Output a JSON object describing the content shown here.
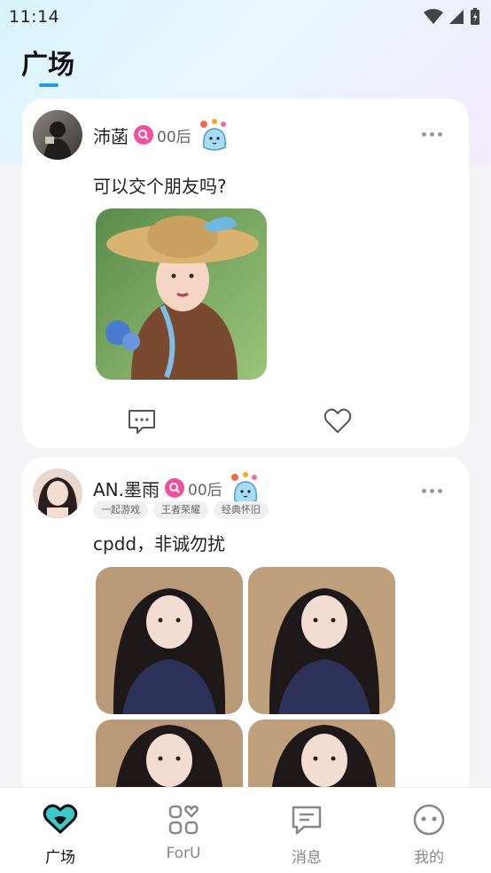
{
  "status_bar": {
    "time": "11:14"
  },
  "header": {
    "title": "广场"
  },
  "posts": [
    {
      "username": "沛菡",
      "age_tag": "00后",
      "text": "可以交个朋友吗?",
      "tags": []
    },
    {
      "username": "AN.墨雨",
      "age_tag": "00后",
      "text": "cpdd，非诚勿扰",
      "tags": [
        "一起游戏",
        "王者荣耀",
        "经典怀旧"
      ]
    }
  ],
  "bottom_nav": {
    "items": [
      {
        "label": "广场",
        "icon": "heart-chat-icon",
        "active": true
      },
      {
        "label": "ForU",
        "icon": "grid-heart-icon",
        "active": false
      },
      {
        "label": "消息",
        "icon": "message-icon",
        "active": false
      },
      {
        "label": "我的",
        "icon": "face-icon",
        "active": false
      }
    ]
  },
  "colors": {
    "accent": "#1e9bf0",
    "badge": "#f04fa0",
    "teal": "#3cc8c8"
  }
}
